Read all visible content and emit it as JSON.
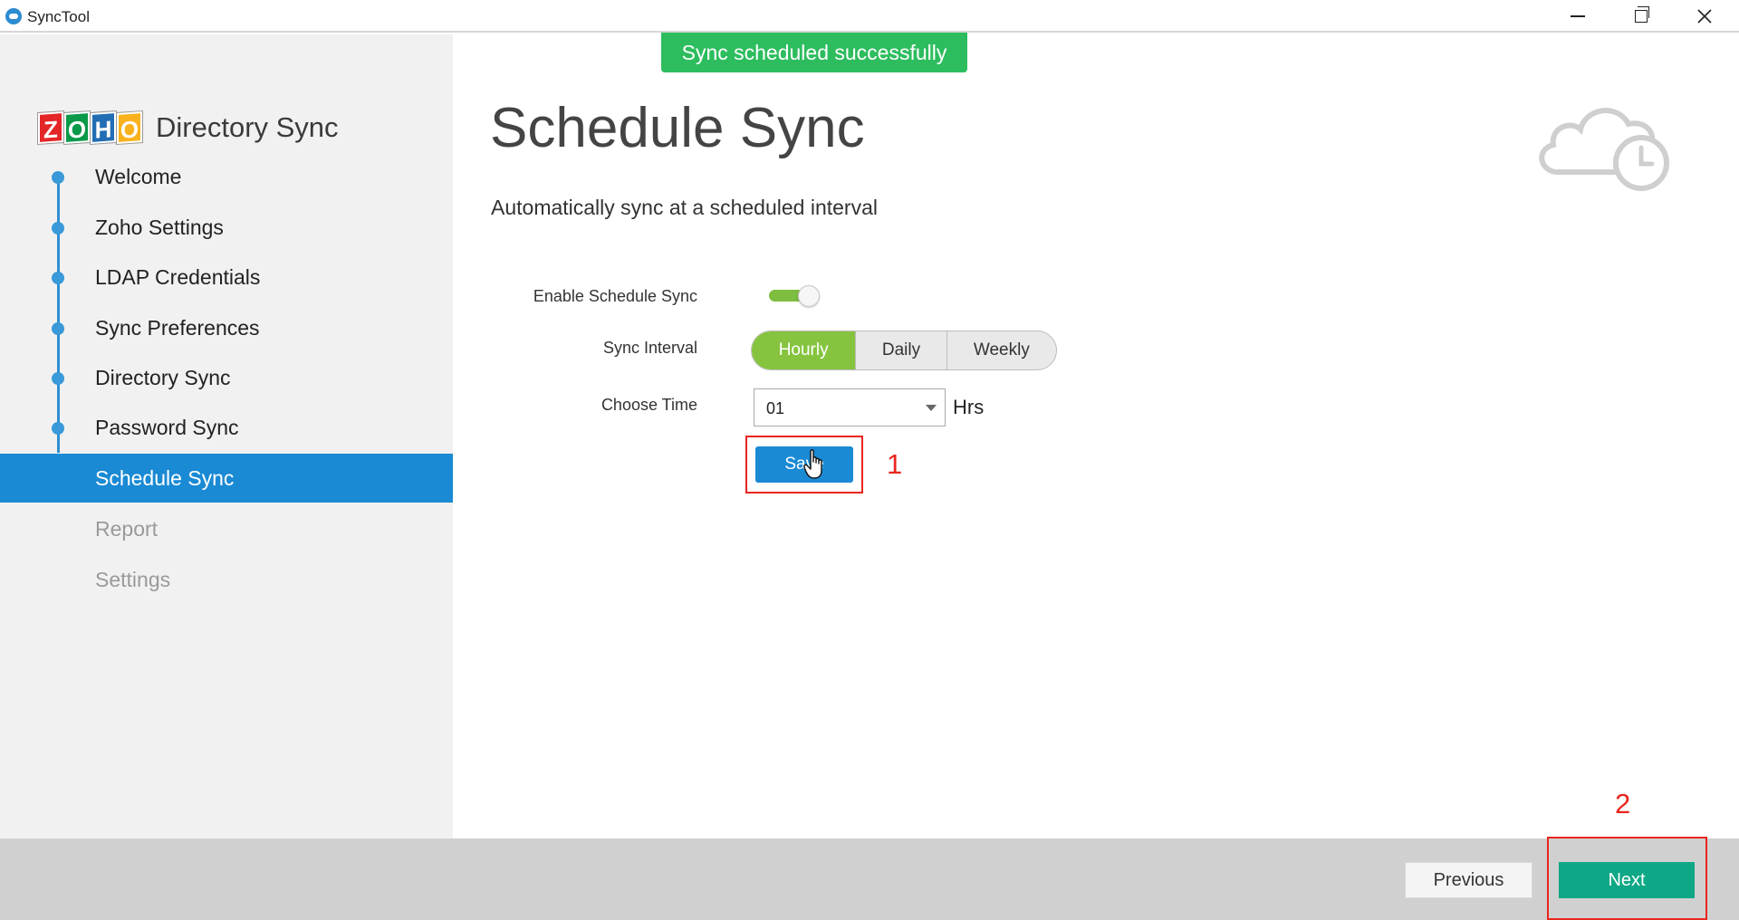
{
  "window": {
    "title": "SyncTool",
    "controls": [
      "minimize",
      "restore",
      "close"
    ]
  },
  "logo": {
    "letters": [
      "Z",
      "O",
      "H",
      "O"
    ],
    "product": "Directory Sync",
    "colors": [
      "#e42527",
      "#089949",
      "#226db4",
      "#f9b21d"
    ]
  },
  "sidebar": {
    "items": [
      {
        "label": "Welcome",
        "state": "completed"
      },
      {
        "label": "Zoho Settings",
        "state": "completed"
      },
      {
        "label": "LDAP Credentials",
        "state": "completed"
      },
      {
        "label": "Sync Preferences",
        "state": "completed"
      },
      {
        "label": "Directory Sync",
        "state": "completed"
      },
      {
        "label": "Password Sync",
        "state": "completed"
      },
      {
        "label": "Schedule Sync",
        "state": "active"
      },
      {
        "label": "Report",
        "state": "disabled"
      },
      {
        "label": "Settings",
        "state": "disabled"
      }
    ]
  },
  "toast": {
    "message": "Sync scheduled successfully",
    "color": "#2dbd5e"
  },
  "main": {
    "title": "Schedule Sync",
    "subtitle": "Automatically sync at a scheduled interval",
    "header_icon": "cloud-clock-icon",
    "form": {
      "enable_label": "Enable Schedule Sync",
      "enable_value": true,
      "interval_label": "Sync Interval",
      "interval_options": [
        "Hourly",
        "Daily",
        "Weekly"
      ],
      "interval_selected": "Hourly",
      "time_label": "Choose Time",
      "time_value": "01",
      "time_unit": "Hrs",
      "save_label": "Save"
    }
  },
  "annotations": {
    "first": "1",
    "second": "2",
    "color": "#e8261e"
  },
  "footer": {
    "previous_label": "Previous",
    "next_label": "Next"
  },
  "colors": {
    "accent": "#1a8ad4",
    "toggle_on": "#7dbd3f",
    "segment_active": "#86c440",
    "next_button": "#0fa886"
  }
}
